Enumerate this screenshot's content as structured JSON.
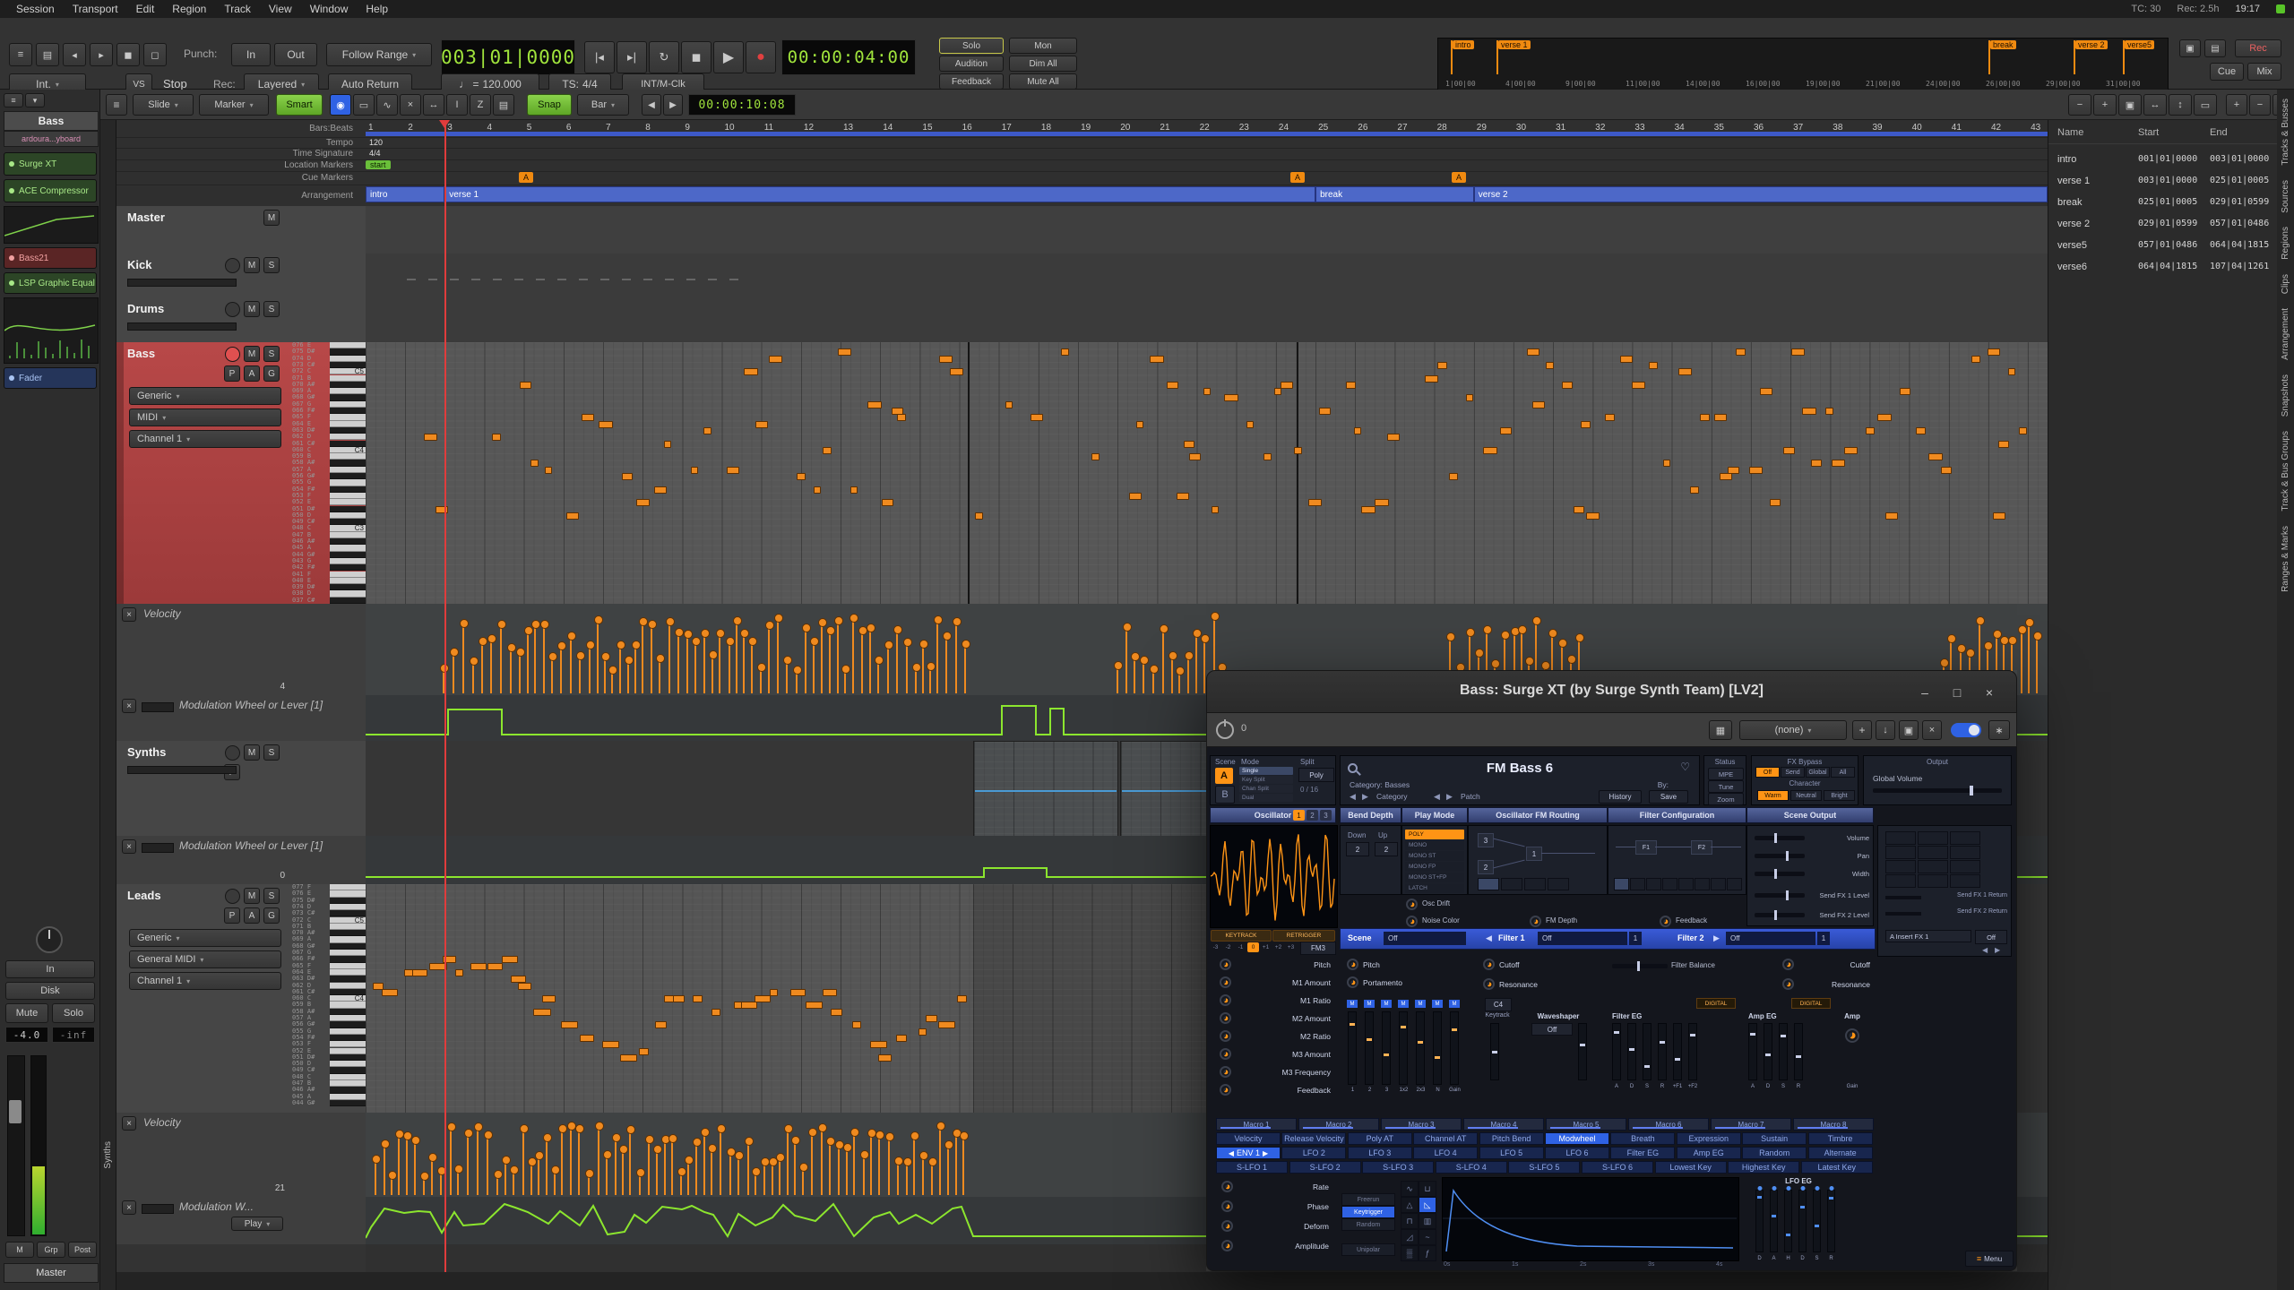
{
  "colors": {
    "note_orange": "#ef8a1f",
    "automation_green": "#8ce62e",
    "arrangement_blue": "#4d68c8",
    "selected_track_red": "#b84848",
    "clock_green": "#a0e43c",
    "surge_orange": "#ff9415",
    "surge_blue": "#2f62e4"
  },
  "menubar": {
    "items": [
      "Session",
      "Transport",
      "Edit",
      "Region",
      "Track",
      "View",
      "Window",
      "Help"
    ],
    "tc": "TC: 30",
    "rec": "Rec: 2.5h",
    "clock": "19:17"
  },
  "icons": {
    "transport_left": [
      "≡",
      "▤",
      "◂",
      "▸",
      "◼",
      "◻"
    ],
    "transport_buttons": [
      "|◂",
      "▸|",
      "↻",
      "◼",
      "▶",
      "●"
    ],
    "window": [
      "▣",
      "▤"
    ],
    "mouse_modes": [
      "◉",
      "▭",
      "∿",
      "×",
      "↔",
      "I",
      "Z",
      "▤"
    ],
    "zoom": [
      "−",
      "+",
      "▣",
      "↔",
      "↕",
      "▭"
    ],
    "track_size": [
      "+",
      "−",
      "≡"
    ]
  },
  "transport": {
    "punch_label": "Punch:",
    "punch_in": "In",
    "punch_out": "Out",
    "follow_range": "Follow Range",
    "primary_clock": "003|01|0000",
    "secondary_clock": "00:00:04:00",
    "solo": "Solo",
    "audition": "Audition",
    "feedback": "Feedback",
    "mon": "Mon",
    "dim_all": "Dim All",
    "mute_all": "Mute All",
    "rec_page": "Rec",
    "cue_page": "Cue",
    "mix_page": "Mix",
    "sync_source": "Int.",
    "vs": "VS",
    "state": "Stop",
    "rec_mode_label": "Rec:",
    "rec_mode": "Layered",
    "auto_return": "Auto Return",
    "tempo_label": "♩ =",
    "tempo": "120.000",
    "ts_label": "TS:",
    "ts": "4/4",
    "clock_mode": "INT/M-Clk",
    "mini_markers": [
      {
        "label": "intro",
        "pos": 0.01
      },
      {
        "label": "verse 1",
        "pos": 0.075
      },
      {
        "label": "break",
        "pos": 0.77
      },
      {
        "label": "verse 2",
        "pos": 0.89
      },
      {
        "label": "verse5",
        "pos": 0.96
      }
    ],
    "mini_ticks": [
      "1|00|00",
      "4|00|00",
      "9|00|00",
      "11|00|00",
      "14|00|00",
      "16|00|00",
      "19|00|00",
      "21|00|00",
      "24|00|00",
      "26|00|00",
      "29|00|00",
      "31|00|00"
    ]
  },
  "editor_toolbar": {
    "edit_mode": "Slide",
    "edit_point": "Marker",
    "smart": "Smart",
    "snap": "Snap",
    "grid": "Bar",
    "nudge_clock": "00:00:10:08"
  },
  "left_strip": {
    "title": "Bass",
    "session": "ardoura...yboard",
    "processors": [
      {
        "name": "Surge XT",
        "kind": "green"
      },
      {
        "name": "ACE Compressor",
        "kind": "green"
      },
      {
        "name": "Bass21",
        "kind": "red"
      },
      {
        "name": "LSP Graphic Equal",
        "kind": "green"
      },
      {
        "name": "Fader",
        "kind": "blue"
      }
    ],
    "input": "In",
    "disk": "Disk",
    "mute": "Mute",
    "solo": "Solo",
    "gain": "-4.0",
    "peak": "-inf",
    "m": "M",
    "grp": "Grp",
    "post": "Post",
    "master": "Master",
    "group_tab": "Synths"
  },
  "rulers": {
    "labels": [
      "Bars:Beats",
      "Tempo",
      "Time Signature",
      "Location Markers",
      "Cue Markers",
      "Arrangement"
    ],
    "tempo_value": "120",
    "ts_value": "4/4",
    "start_marker": "start",
    "bars": [
      1,
      2,
      3,
      4,
      5,
      6,
      7,
      8,
      9,
      10,
      11,
      12,
      13,
      14,
      15,
      16,
      17,
      18,
      19,
      20,
      21,
      22,
      23,
      24,
      25,
      26,
      27,
      28,
      29,
      30,
      31,
      32,
      33,
      34,
      35,
      36,
      37,
      38,
      39,
      40,
      41,
      42,
      43
    ],
    "cue_markers": [
      "A",
      "A",
      "A"
    ],
    "arrangement": [
      {
        "label": "intro",
        "from": 1,
        "to": 3
      },
      {
        "label": "verse 1",
        "from": 3,
        "to": 25
      },
      {
        "label": "break",
        "from": 25,
        "to": 29
      },
      {
        "label": "verse 2",
        "from": 29,
        "to": 43.5
      }
    ]
  },
  "tracks": [
    {
      "name": "Master",
      "mute": "M"
    },
    {
      "name": "Kick",
      "mute": "M",
      "solo": "S"
    },
    {
      "name": "Drums",
      "mute": "M",
      "solo": "S"
    },
    {
      "name": "Bass",
      "mute": "M",
      "solo": "S",
      "playlist": "P",
      "automation": "A",
      "group": "G",
      "dropdowns": [
        "Generic",
        "MIDI",
        "Channel 1"
      ],
      "top_note": 76,
      "key_labels": {
        "72": "C5",
        "60": "C4",
        "48": "C3"
      }
    },
    {
      "lane": "Velocity",
      "value": "4"
    },
    {
      "lane": "Modulation Wheel or Lever [1]"
    },
    {
      "name": "Synths",
      "mute": "M",
      "solo": "S",
      "playlist": "P"
    },
    {
      "lane": "Modulation Wheel or Lever [1]",
      "value": "0"
    },
    {
      "name": "Leads",
      "mute": "M",
      "solo": "S",
      "playlist": "P",
      "automation": "A",
      "group": "G",
      "dropdowns": [
        "Generic",
        "General MIDI",
        "Channel 1"
      ],
      "top_note": 77,
      "key_labels": {
        "72": "C5",
        "60": "C4"
      }
    },
    {
      "lane": "Velocity",
      "value": "21"
    },
    {
      "lane": "Modulation W...",
      "dropdown": "Play"
    }
  ],
  "arrangement_panel": {
    "columns": [
      "Name",
      "Start",
      "End"
    ],
    "rows": [
      [
        "intro",
        "001|01|0000",
        "003|01|0000"
      ],
      [
        "verse 1",
        "003|01|0000",
        "025|01|0005"
      ],
      [
        "break",
        "025|01|0005",
        "029|01|0599"
      ],
      [
        "verse 2",
        "029|01|0599",
        "057|01|0486"
      ],
      [
        "verse5",
        "057|01|0486",
        "064|04|1815"
      ],
      [
        "verse6",
        "064|04|1815",
        "107|04|1261"
      ]
    ]
  },
  "right_tabs": [
    "Tracks & Busses",
    "Sources",
    "Regions",
    "Clips",
    "Arrangement",
    "Snapshots",
    "Track & Bus Groups",
    "Ranges & Marks"
  ],
  "plugin": {
    "title": "Bass: Surge XT (by Surge Synth Team) [LV2]",
    "window_buttons": {
      "minimize": "–",
      "maximize": "□",
      "close": "×"
    },
    "toolbar": {
      "power_value": "0",
      "preset": "(none)",
      "add": "+"
    },
    "surge": {
      "scene": {
        "label": "Scene",
        "a": "A",
        "b": "B"
      },
      "mode": {
        "label": "Mode",
        "options": [
          "Single",
          "Key Split",
          "Chan Split",
          "Dual"
        ]
      },
      "split": {
        "label": "Split",
        "mode": "Poly",
        "voices": "0 / 16"
      },
      "patch": {
        "name": "FM Bass 6",
        "category": "Category: Basses",
        "by": "By:",
        "category_nav": "Category",
        "patch_nav": "Patch",
        "history": "History",
        "save": "Save"
      },
      "status": {
        "label": "Status",
        "buttons": [
          "MPE",
          "Tune",
          "Zoom"
        ]
      },
      "fx_bypass": {
        "label": "FX Bypass",
        "options": [
          "Off",
          "Send",
          "Global",
          "All"
        ],
        "active": "Off"
      },
      "character": {
        "label": "Character",
        "options": [
          "Warm",
          "Neutral",
          "Bright"
        ],
        "active": "Warm"
      },
      "output": {
        "label": "Output",
        "volume": "Global Volume"
      },
      "sections": [
        "Oscillator",
        "Bend Depth",
        "Play Mode",
        "Oscillator FM Routing",
        "Filter Configuration",
        "Scene Output"
      ],
      "osc": {
        "tabs": [
          "1",
          "2",
          "3"
        ],
        "keytrack": "KEYTRACK",
        "retrigger": "RETRIGGER",
        "octaves": [
          "-3",
          "-2",
          "-1",
          "0",
          "+1",
          "+2",
          "+3"
        ],
        "type": "FM3"
      },
      "bend": {
        "down": "Down",
        "up": "Up",
        "down_value": "2",
        "up_value": "2"
      },
      "play_modes": [
        "POLY",
        "MONO",
        "MONO ST",
        "MONO FP",
        "MONO ST+FP",
        "LATCH"
      ],
      "drift": "Osc Drift",
      "noise": "Noise Color",
      "fm_depth": "FM Depth",
      "feedback": "Feedback",
      "scene_output": [
        "Volume",
        "Pan",
        "Width",
        "Send FX 1 Level",
        "Send FX 2 Level"
      ],
      "filter_strip": {
        "scene": "Scene",
        "scene_value": "Off",
        "f1": "Filter 1",
        "f1_value": "Off",
        "f1_sub": "1",
        "f2": "Filter 2",
        "f2_value": "Off",
        "f2_sub": "1"
      },
      "osc_params": [
        "Pitch",
        "M1 Amount",
        "M1 Ratio",
        "M2 Amount",
        "M2 Ratio",
        "M3 Amount",
        "M3 Frequency",
        "Feedback"
      ],
      "scene_params": [
        "Pitch",
        "Portamento"
      ],
      "mixer": {
        "mute": "M",
        "labels": [
          "1",
          "2",
          "3",
          "1x2",
          "2x3",
          "N",
          "Gain"
        ]
      },
      "filter": {
        "cutoff": "Cutoff",
        "resonance": "Resonance",
        "keytrack": "Keytrack",
        "keytrack_value": "C4",
        "balance": "Filter Balance"
      },
      "waveshaper": {
        "label": "Waveshaper",
        "type": "Off"
      },
      "filter_eg": {
        "label": "Filter EG",
        "mode": "DIGITAL",
        "sliders": [
          "A",
          "D",
          "S",
          "R",
          "+F1",
          "+F2"
        ]
      },
      "amp_eg": {
        "label": "Amp EG",
        "mode": "DIGITAL",
        "sliders": [
          "A",
          "D",
          "S",
          "R"
        ]
      },
      "amp": {
        "label": "Amp",
        "gain": "Gain"
      },
      "fx_panel": {
        "send1": "Send FX 1 Return",
        "send2": "Send FX 2 Return",
        "insert": "A Insert FX 1",
        "insert_value": "Off"
      },
      "mod_matrix": {
        "macros": [
          "Macro 1",
          "Macro 2",
          "Macro 3",
          "Macro 4",
          "Macro 5",
          "Macro 6",
          "Macro 7",
          "Macro 8"
        ],
        "row2": [
          "Velocity",
          "Release Velocity",
          "Poly AT",
          "Channel AT",
          "Pitch Bend",
          "Modwheel",
          "Breath",
          "Expression",
          "Sustain",
          "Timbre"
        ],
        "row2_active": "Modwheel",
        "row3": [
          "ENV 1",
          "LFO 2",
          "LFO 3",
          "LFO 4",
          "LFO 5",
          "LFO 6",
          "Filter EG",
          "Amp EG",
          "Random",
          "Alternate"
        ],
        "row3_active": "ENV 1",
        "row4": [
          "S-LFO 1",
          "S-LFO 2",
          "S-LFO 3",
          "S-LFO 4",
          "S-LFO 5",
          "S-LFO 6",
          "Lowest Key",
          "Highest Key",
          "Latest Key"
        ]
      },
      "lfo": {
        "params": [
          "Rate",
          "Phase",
          "Deform",
          "Amplitude"
        ],
        "triggers": [
          "Freerun",
          "Keytrigger",
          "Random"
        ],
        "trigger_active": "Keytrigger",
        "unipolar": "Unipolar",
        "time_ticks": [
          "0s",
          "1s",
          "2s",
          "3s",
          "4s"
        ],
        "eg": {
          "label": "LFO EG",
          "sliders": [
            "D",
            "A",
            "H",
            "D",
            "S",
            "R"
          ]
        },
        "menu": "Menu"
      }
    }
  }
}
